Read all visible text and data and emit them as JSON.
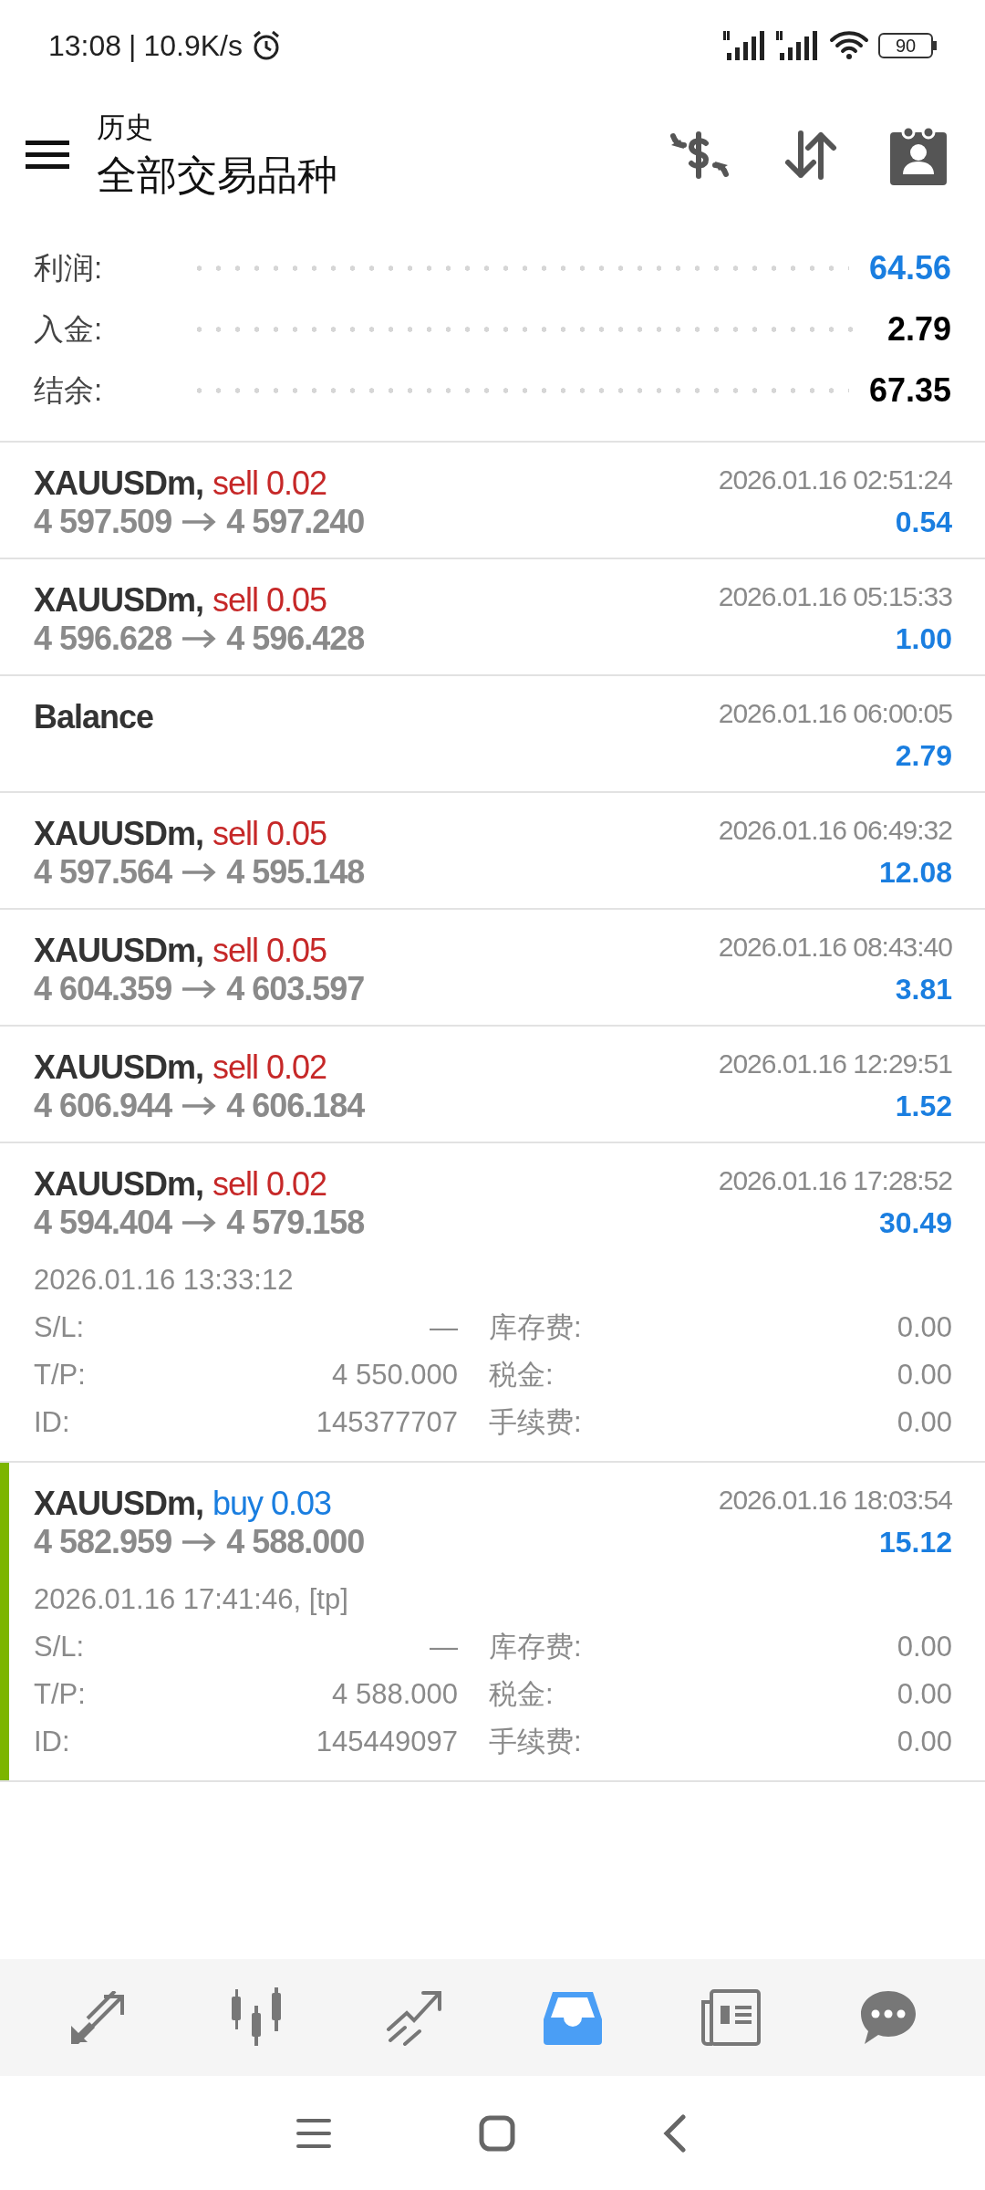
{
  "status_bar": {
    "time": "13:08",
    "separator": "|",
    "speed": "10.9K/s",
    "battery": "90"
  },
  "header": {
    "subtitle": "历史",
    "title": "全部交易品种"
  },
  "summary": [
    {
      "label": "利润:",
      "value": "64.56",
      "color": "#1a7ee0"
    },
    {
      "label": "入金:",
      "value": "2.79",
      "color": "#000000"
    },
    {
      "label": "结余:",
      "value": "67.35",
      "color": "#000000"
    }
  ],
  "deals": [
    {
      "kind": "trade",
      "selected": false,
      "symbol": "XAUUSDm,",
      "side": "sell 0.02",
      "color": "#c62828",
      "open_price": "4 597.509",
      "close_price": "4 597.240",
      "time": "2026.01.16 02:51:24",
      "profit": "0.54"
    },
    {
      "kind": "trade",
      "selected": false,
      "symbol": "XAUUSDm,",
      "side": "sell 0.05",
      "color": "#c62828",
      "open_price": "4 596.628",
      "close_price": "4 596.428",
      "time": "2026.01.16 05:15:33",
      "profit": "1.00"
    },
    {
      "kind": "balance",
      "selected": false,
      "symbol": "Balance",
      "time": "2026.01.16 06:00:05",
      "profit": "2.79"
    },
    {
      "kind": "trade",
      "selected": false,
      "symbol": "XAUUSDm,",
      "side": "sell 0.05",
      "color": "#c62828",
      "open_price": "4 597.564",
      "close_price": "4 595.148",
      "time": "2026.01.16 06:49:32",
      "profit": "12.08"
    },
    {
      "kind": "trade",
      "selected": false,
      "symbol": "XAUUSDm,",
      "side": "sell 0.05",
      "color": "#c62828",
      "open_price": "4 604.359",
      "close_price": "4 603.597",
      "time": "2026.01.16 08:43:40",
      "profit": "3.81"
    },
    {
      "kind": "trade",
      "selected": false,
      "symbol": "XAUUSDm,",
      "side": "sell 0.02",
      "color": "#c62828",
      "open_price": "4 606.944",
      "close_price": "4 606.184",
      "time": "2026.01.16 12:29:51",
      "profit": "1.52"
    },
    {
      "kind": "trade",
      "selected": false,
      "symbol": "XAUUSDm,",
      "side": "sell 0.02",
      "color": "#c62828",
      "open_price": "4 594.404",
      "close_price": "4 579.158",
      "time": "2026.01.16 17:28:52",
      "profit": "30.49",
      "details": {
        "open_time": "2026.01.16 13:33:12",
        "rows": [
          {
            "label": "S/L:",
            "value": "—",
            "label2": "库存费:",
            "value2": "0.00"
          },
          {
            "label": "T/P:",
            "value": "4 550.000",
            "label2": "税金:",
            "value2": "0.00"
          },
          {
            "label": "ID:",
            "value": "145377707",
            "label2": "手续费:",
            "value2": "0.00"
          }
        ]
      }
    },
    {
      "kind": "trade",
      "selected": true,
      "symbol": "XAUUSDm,",
      "side": "buy 0.03",
      "color": "#1a7ee0",
      "open_price": "4 582.959",
      "close_price": "4 588.000",
      "time": "2026.01.16 18:03:54",
      "profit": "15.12",
      "details": {
        "open_time": "2026.01.16 17:41:46, [tp]",
        "rows": [
          {
            "label": "S/L:",
            "value": "—",
            "label2": "库存费:",
            "value2": "0.00"
          },
          {
            "label": "T/P:",
            "value": "4 588.000",
            "label2": "税金:",
            "value2": "0.00"
          },
          {
            "label": "ID:",
            "value": "145449097",
            "label2": "手续费:",
            "value2": "0.00"
          }
        ]
      }
    }
  ],
  "bottom_nav": [
    {
      "kind": "trade",
      "selected": false
    },
    {
      "kind": "quotes",
      "selected": false
    },
    {
      "kind": "chart",
      "selected": false
    },
    {
      "kind": "history",
      "selected": true
    },
    {
      "kind": "news",
      "selected": false
    },
    {
      "kind": "chat",
      "selected": false
    }
  ]
}
